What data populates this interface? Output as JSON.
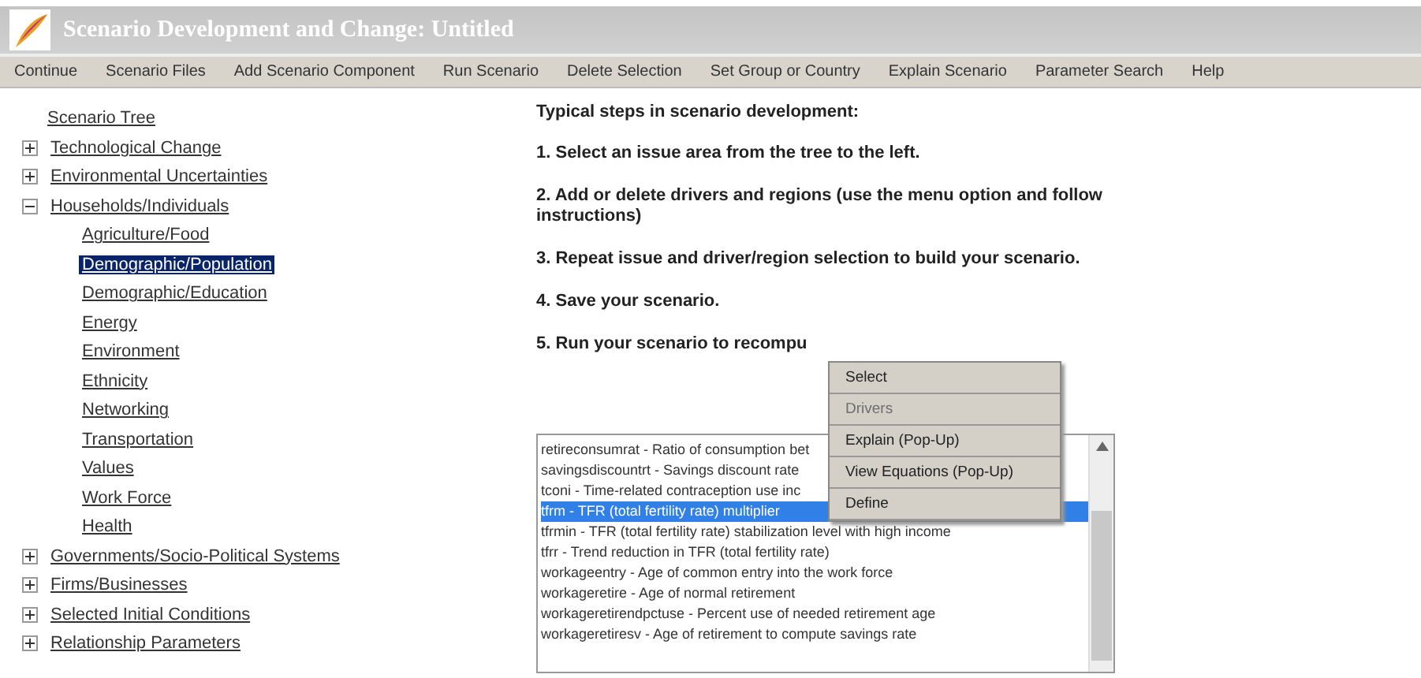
{
  "window": {
    "title": "Scenario Development and Change: Untitled"
  },
  "menu": [
    "Continue",
    "Scenario Files",
    "Add Scenario Component",
    "Run Scenario",
    "Delete Selection",
    "Set Group or Country",
    "Explain Scenario",
    "Parameter Search",
    "Help"
  ],
  "tree": {
    "root": "Scenario Tree",
    "items": [
      {
        "label": "Technological Change",
        "expanded": false,
        "selected": false
      },
      {
        "label": "Environmental Uncertainties",
        "expanded": false,
        "selected": false
      },
      {
        "label": "Households/Individuals",
        "expanded": true,
        "selected": false,
        "children": [
          {
            "label": "Agriculture/Food",
            "selected": false
          },
          {
            "label": "Demographic/Population",
            "selected": true
          },
          {
            "label": "Demographic/Education",
            "selected": false
          },
          {
            "label": "Energy",
            "selected": false
          },
          {
            "label": "Environment",
            "selected": false
          },
          {
            "label": "Ethnicity",
            "selected": false
          },
          {
            "label": "Networking",
            "selected": false
          },
          {
            "label": "Transportation",
            "selected": false
          },
          {
            "label": "Values",
            "selected": false
          },
          {
            "label": "Work Force",
            "selected": false
          },
          {
            "label": "Health",
            "selected": false
          }
        ]
      },
      {
        "label": "Governments/Socio-Political Systems",
        "expanded": false,
        "selected": false
      },
      {
        "label": "Firms/Businesses",
        "expanded": false,
        "selected": false
      },
      {
        "label": "Selected Initial Conditions",
        "expanded": false,
        "selected": false
      },
      {
        "label": "Relationship Parameters",
        "expanded": false,
        "selected": false
      }
    ]
  },
  "steps": {
    "heading": "Typical steps in scenario development:",
    "items": [
      "1. Select an issue area from the tree to the left.",
      "2. Add or delete drivers and regions (use the menu option and follow instructions)",
      "3. Repeat issue and driver/region selection to build your scenario.",
      "4. Save your scenario.",
      "5. Run your scenario to recompu"
    ]
  },
  "parameters": [
    {
      "text": "retireconsumrat - Ratio of consumption bet",
      "selected": false
    },
    {
      "text": "savingsdiscountrt - Savings discount rate",
      "selected": false
    },
    {
      "text": "tconi - Time-related contraception use inc",
      "selected": false
    },
    {
      "text": "tfrm - TFR (total fertility rate) multiplier",
      "selected": true
    },
    {
      "text": "tfrmin - TFR (total fertility rate) stabilization level with high income",
      "selected": false
    },
    {
      "text": "tfrr - Trend reduction in TFR (total fertility rate)",
      "selected": false
    },
    {
      "text": "workageentry - Age of common entry into the work force",
      "selected": false
    },
    {
      "text": "workageretire - Age of normal retirement",
      "selected": false
    },
    {
      "text": "workageretirendpctuse - Percent use of needed retirement age",
      "selected": false
    },
    {
      "text": "workageretiresv - Age of retirement to compute savings rate",
      "selected": false
    }
  ],
  "context_menu": [
    {
      "label": "Select",
      "disabled": false
    },
    {
      "label": "Drivers",
      "disabled": true
    },
    {
      "label": "Explain (Pop-Up)",
      "disabled": false
    },
    {
      "label": "View Equations (Pop-Up)",
      "disabled": false
    },
    {
      "label": "Define",
      "disabled": false
    }
  ]
}
